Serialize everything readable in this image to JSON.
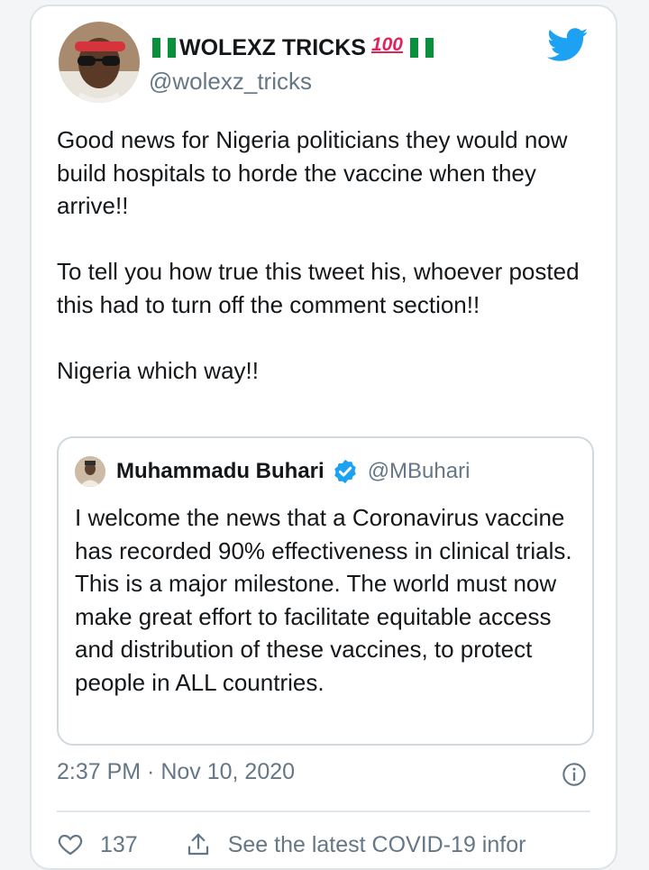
{
  "tweet": {
    "display_name": "WOLEXZ TRICKS",
    "hundred_emoji": "100",
    "handle": "@wolexz_tricks",
    "paragraphs": [
      "Good news for Nigeria politicians they would now build hospitals to horde the vaccine when they arrive!!",
      "To tell you how true this tweet his, whoever posted this had to turn off the comment section!!",
      "Nigeria which way!!"
    ],
    "timestamp": "2:37 PM · Nov 10, 2020"
  },
  "quoted_tweet": {
    "name": "Muhammadu Buhari",
    "handle": "@MBuhari",
    "text": "I welcome the news that a Coronavirus vaccine has recorded 90% effectiveness in clinical trials. This is a major milestone. The world must now make great effort to facilitate equitable access and distribution of these vaccines, to protect people in ALL countries."
  },
  "actions": {
    "like_count": "137",
    "share_text": "See the latest COVID-19 infor"
  },
  "icons": {
    "brand": "twitter-bird-icon",
    "verified": "verified-badge-icon",
    "info": "info-icon",
    "like": "heart-icon",
    "share": "share-icon"
  },
  "colors": {
    "twitter_blue": "#1da1f2",
    "text": "#14171a",
    "secondary_text": "#657786",
    "nigeria_green": "#0a8f3c",
    "emoji_red": "#e0245e"
  }
}
